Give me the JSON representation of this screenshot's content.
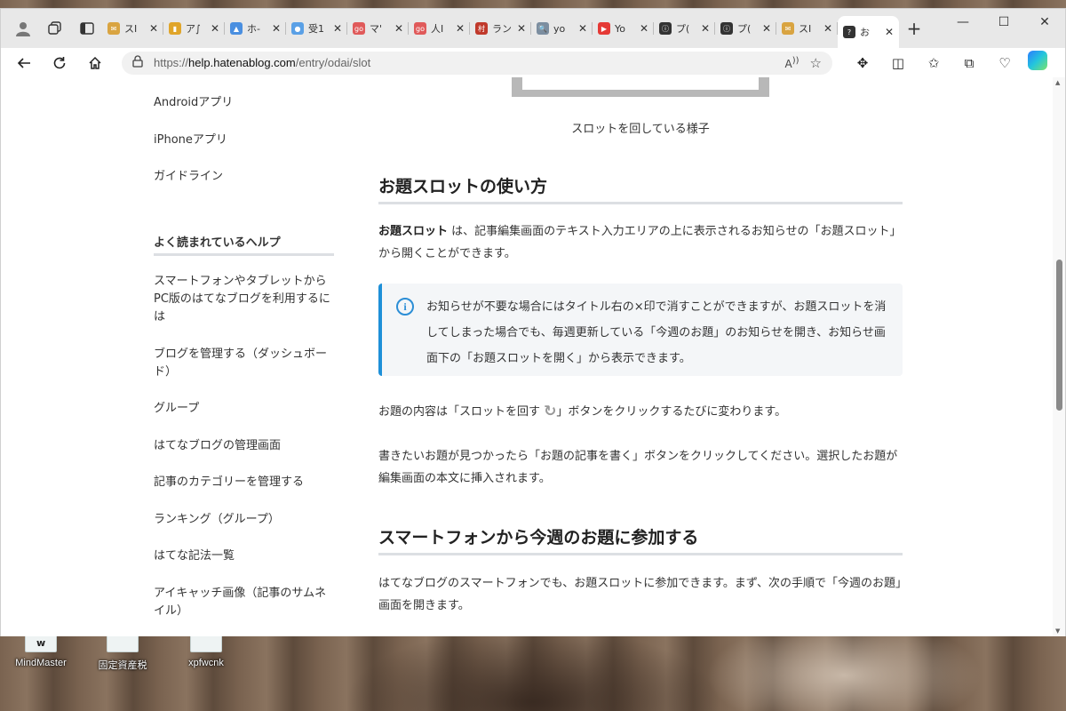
{
  "browser": {
    "tabs": [
      {
        "label": "スI",
        "color": "#d9a441",
        "glyph": "✉"
      },
      {
        "label": "ア∫",
        "color": "#e0a52a",
        "glyph": "▮"
      },
      {
        "label": "ホ-",
        "color": "#4a8fe0",
        "glyph": "▲"
      },
      {
        "label": "受1",
        "color": "#5aa0e6",
        "glyph": "●"
      },
      {
        "label": "マ'",
        "color": "#e05a5a",
        "glyph": "go"
      },
      {
        "label": "人I",
        "color": "#e05a5a",
        "glyph": "go"
      },
      {
        "label": "ラン",
        "color": "#c0392b",
        "glyph": "村"
      },
      {
        "label": "yo",
        "color": "#7c8ea0",
        "glyph": "🔍"
      },
      {
        "label": "Yo",
        "color": "#e53935",
        "glyph": "▶"
      },
      {
        "label": "プ(",
        "color": "#333333",
        "glyph": "ⓘ"
      },
      {
        "label": "プ(",
        "color": "#333333",
        "glyph": "ⓘ"
      },
      {
        "label": "スI",
        "color": "#d9a441",
        "glyph": "✉"
      },
      {
        "label": "お",
        "color": "#333333",
        "glyph": "?"
      }
    ],
    "url_prefix": "https://",
    "url_host": "help.hatenablog.com",
    "url_path": "/entry/odai/slot"
  },
  "sidebar": {
    "links_top": [
      "Androidアプリ",
      "iPhoneアプリ",
      "ガイドライン"
    ],
    "section_title": "よく読まれているヘルプ",
    "links": [
      "スマートフォンやタブレットからPC版のはてなブログを利用するには",
      "ブログを管理する（ダッシュボード）",
      "グループ",
      "はてなブログの管理画面",
      "記事のカテゴリーを管理する",
      "ランキング（グループ）",
      "はてな記法一覧",
      "アイキャッチ画像（記事のサムネイル）"
    ]
  },
  "main": {
    "caption": "スロットを回している様子",
    "h2_usage": "お題スロットの使い方",
    "p1_bold": "お題スロット",
    "p1_rest": " は、記事編集画面のテキスト入力エリアの上に表示されるお知らせの「お題スロット」から開くことができます。",
    "info_text": "お知らせが不要な場合にはタイトル右の×印で消すことができますが、お題スロットを消してしまった場合でも、毎週更新している「今週のお題」のお知らせを開き、お知らせ画面下の「お題スロットを開く」から表示できます。",
    "p2_before": "お題の内容は「スロットを回す ",
    "p2_after": "」ボタンをクリックするたびに変わります。",
    "p3": "書きたいお題が見つかったら「お題の記事を書く」ボタンをクリックしてください。選択したお題が編集画面の本文に挿入されます。",
    "h2_smartphone": "スマートフォンから今週のお題に参加する",
    "p4": "はてなブログのスマートフォンでも、お題スロットに参加できます。まず、次の手順で「今週のお題」画面を開きます。"
  },
  "desktop": {
    "icons": [
      "MindMaster",
      "固定資産税",
      "xpfwcnk"
    ]
  }
}
